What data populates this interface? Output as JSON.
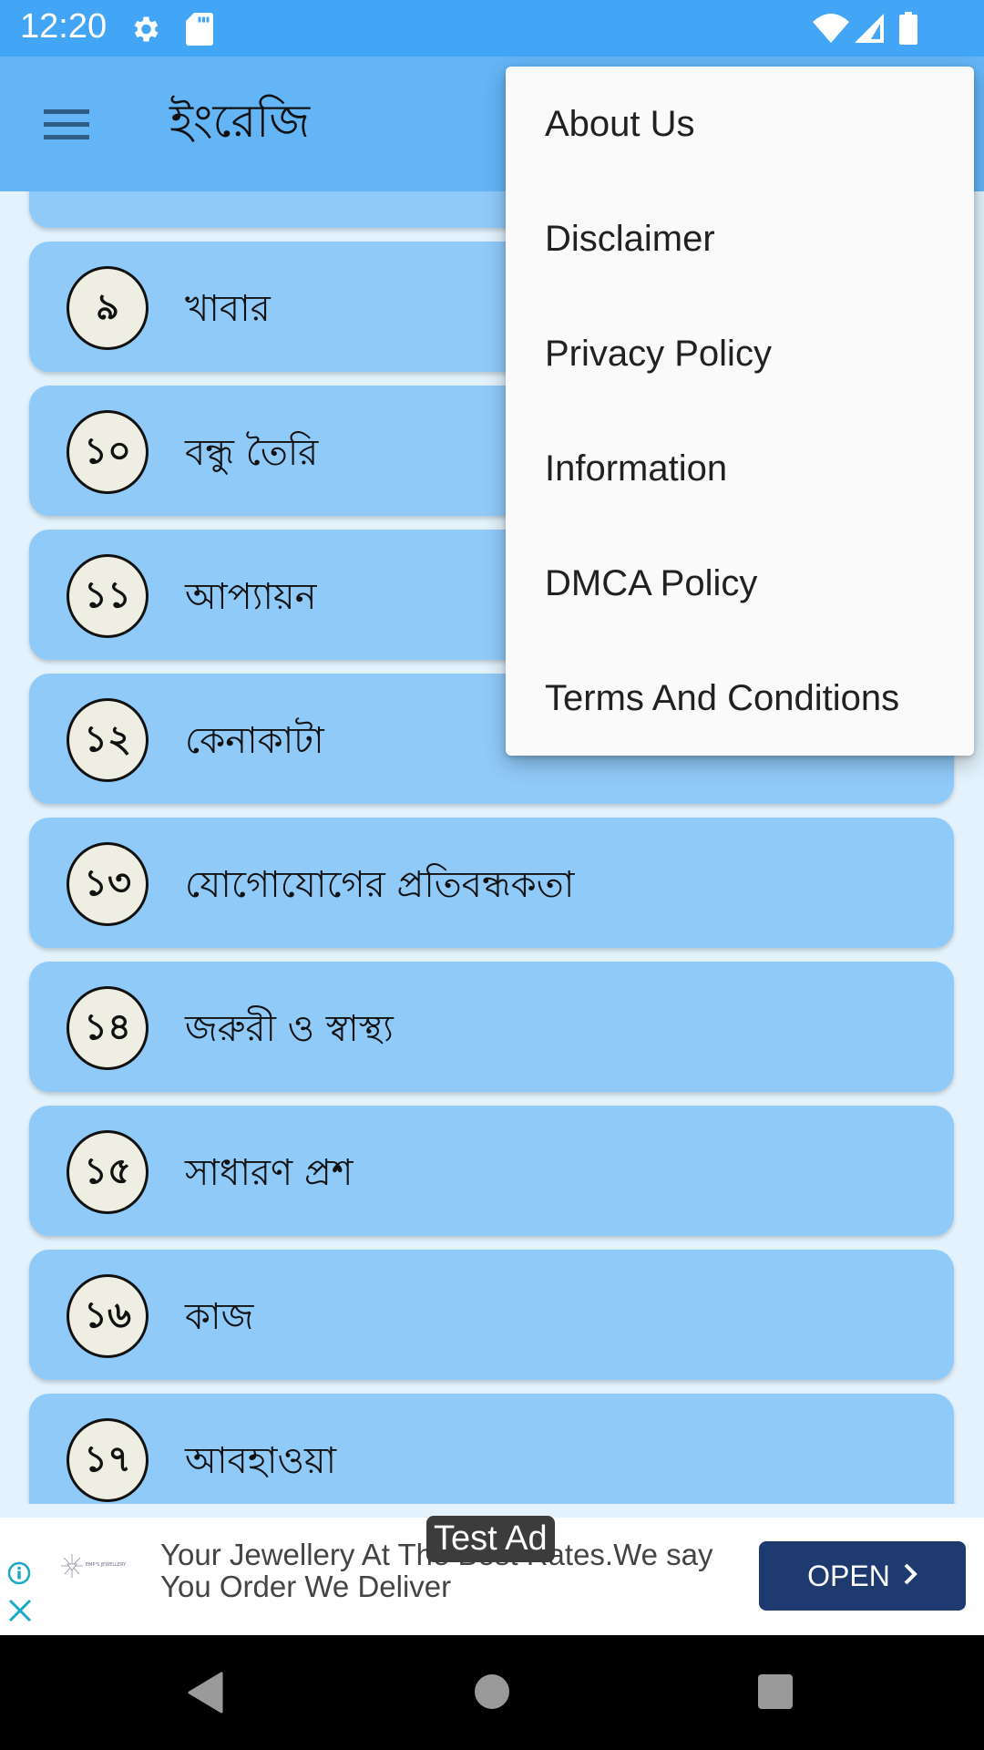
{
  "status_bar": {
    "time": "12:20",
    "left_icons": [
      "settings-icon",
      "sd-card-icon"
    ],
    "right_icons": [
      "wifi-icon",
      "signal-icon",
      "battery-icon"
    ]
  },
  "toolbar": {
    "menu_icon": "hamburger-menu-icon",
    "title": "ইংরেজি"
  },
  "lessons": [
    {
      "number": "৯",
      "title": "খাবার"
    },
    {
      "number": "১০",
      "title": "বন্ধু তৈরি"
    },
    {
      "number": "১১",
      "title": "আপ্যায়ন"
    },
    {
      "number": "১২",
      "title": "কেনাকাটা"
    },
    {
      "number": "১৩",
      "title": "যোগোযোগের প্রতিবন্ধকতা"
    },
    {
      "number": "১৪",
      "title": "জরুরী ও স্বাস্থ্য"
    },
    {
      "number": "১৫",
      "title": "সাধারণ প্রশ"
    },
    {
      "number": "১৬",
      "title": "কাজ"
    },
    {
      "number": "১৭",
      "title": "আবহাওয়া"
    }
  ],
  "overflow_menu": {
    "items": [
      {
        "label": "About Us"
      },
      {
        "label": "Disclaimer"
      },
      {
        "label": "Privacy Policy"
      },
      {
        "label": "Information"
      },
      {
        "label": "DMCA Policy"
      },
      {
        "label": "Terms And Conditions"
      }
    ]
  },
  "ad": {
    "badge": "Test Ad",
    "logo_text": "EMP'S JEWELLERY",
    "text": "Your Jewellery At The Best Rates.We say You Order We Deliver",
    "cta": "OPEN",
    "cta_color": "#1e3a6e",
    "info_icon": "ad-info-icon",
    "close_icon": "ad-close-icon"
  },
  "nav_bar": {
    "buttons": [
      "back-icon",
      "home-icon",
      "recents-icon"
    ]
  },
  "colors": {
    "status_bar": "#42a5f5",
    "toolbar": "#64b5f6",
    "background": "#e3f2fd",
    "card": "#90caf9",
    "number_circle": "#eeeee2",
    "menu_background": "#fafafa"
  }
}
